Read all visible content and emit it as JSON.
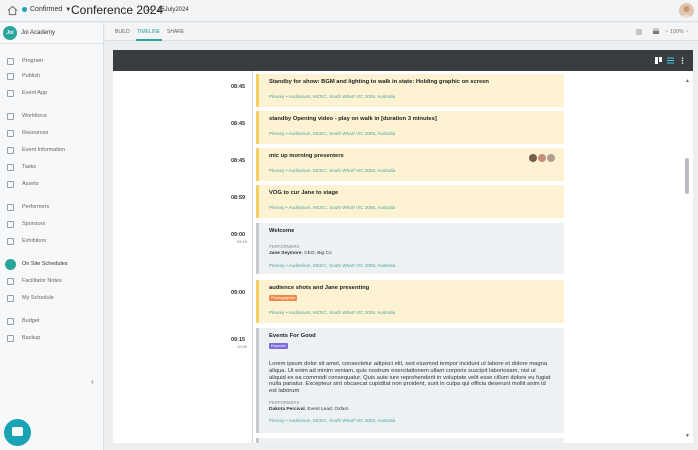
{
  "header": {
    "status": "Confirmed",
    "title": "Conference 2024",
    "dates": "24 - 25July2024"
  },
  "sidebar": {
    "brand": "Joi Academy",
    "logo_text": "Joi",
    "items": [
      {
        "label": "Program"
      },
      {
        "label": "Publish"
      },
      {
        "label": "Event App"
      },
      {
        "label": "Workforce"
      },
      {
        "label": "Resources"
      },
      {
        "label": "Event Information"
      },
      {
        "label": "Tasks"
      },
      {
        "label": "Assets"
      },
      {
        "label": "Performers"
      },
      {
        "label": "Sponsors"
      },
      {
        "label": "Exhibitors"
      },
      {
        "label": "On Site Schedules"
      },
      {
        "label": "Facilitator Notes"
      },
      {
        "label": "My Schedule"
      },
      {
        "label": "Budget"
      },
      {
        "label": "Backup"
      }
    ]
  },
  "tabs": {
    "build": "BUILD",
    "timeline": "TIMELINE",
    "share": "SHARE",
    "zoom": "~ 100% ~"
  },
  "timeline": {
    "items": [
      {
        "time": "08:45",
        "title": "Standby for show: BGM and lighting to walk in state: Holding graphic on screen",
        "location": "Plenary • Auditorium, MCEC, South Wharf VIC 3006, Australia"
      },
      {
        "time": "08:45",
        "title": "standby Opening video - play on walk in [duration 3 minutes]",
        "location": "Plenary • Auditorium, MCEC, South Wharf VIC 3006, Australia"
      },
      {
        "time": "08:45",
        "title": "mic up morning presenters",
        "location": "Plenary • Auditorium, MCEC, South Wharf VIC 3006, Australia"
      },
      {
        "time": "08:59",
        "title": "VOG to cur Jane to stage",
        "location": "Plenary • Auditorium, MCEC, South Wharf VIC 3006, Australia"
      },
      {
        "time": "09:00",
        "end": "09:15",
        "title": "Welcome",
        "performers_label": "PERFORMERS",
        "performer_name": "Jane Seymore",
        "performer_role": ", CEO, Big Co",
        "location": "Plenary • Auditorium, MCEC, South Wharf VIC 3006, Australia"
      },
      {
        "time": "09:00",
        "title": "audience shots and Jane presenting",
        "badge": "Photographer",
        "location": "Plenary • Auditorium, MCEC, South Wharf VIC 3006, Australia"
      },
      {
        "time": "09:15",
        "end": "10:00",
        "title": "Events For Good",
        "badge": "Keynote",
        "description": "Lorem ipsum dolor sit amet, consectetur adipisci elit, sed eiusmod tempor incidunt ut labore et dolore magna aliqua. Ut enim ad minim veniam, quis nostrum exercitationem ullam corporis suscipit laboriosam, nisi ut aliquid ex ea commodi consequatur. Quis aute iure reprehenderit in voluptate velit esse cillum dolore eu fugiat nulla pariatur. Excepteur sint obcaecat cupiditat non proident, sunt in culpa qui officia deserunt mollit anim id est laborum",
        "performers_label": "PERFORMERS",
        "performer_name": "Dakota Percival",
        "performer_role": ", Event Lead, Oxfam",
        "location": "Plenary • Auditorium, MCEC, South Wharf VIC 3006, Australia"
      }
    ]
  },
  "colors": {
    "accent": "#2aa49a",
    "cue_bg": "#fdf3d3",
    "cue_border": "#f5cf61",
    "session_bg": "#eef1f3",
    "panel_header": "#383d42",
    "photographer_badge": "#f0894a",
    "keynote_badge": "#7b6ad8"
  }
}
